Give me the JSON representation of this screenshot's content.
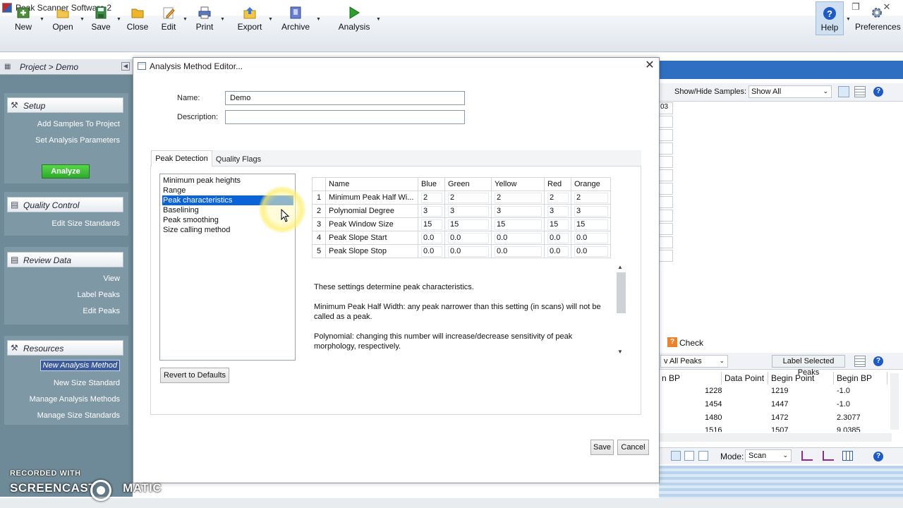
{
  "window": {
    "title": "Peak Scanner Software 2"
  },
  "toolbar": {
    "new": "New",
    "open": "Open",
    "save": "Save",
    "close": "Close",
    "edit": "Edit",
    "print": "Print",
    "export": "Export",
    "archive": "Archive",
    "analysis": "Analysis",
    "help": "Help",
    "preferences": "Preferences"
  },
  "nav": {
    "title": "Project > Demo",
    "setup": "Setup",
    "add_samples": "Add Samples To Project",
    "set_params": "Set Analysis Parameters",
    "analyze": "Analyze",
    "quality_control": "Quality Control",
    "edit_size_standards": "Edit Size Standards",
    "review_data": "Review Data",
    "view": "View",
    "label_peaks": "Label Peaks",
    "edit_peaks": "Edit Peaks",
    "resources": "Resources",
    "new_analysis_method": "New Analysis Method",
    "new_size_standard": "New  Size Standard",
    "manage_analysis_methods": "Manage Analysis Methods",
    "manage_size_standards": "Manage Size Standards"
  },
  "background": {
    "show_hide_label": "Show/Hide Samples:",
    "show_hide_value": "Show All",
    "sample_fragment": "03",
    "check": "Check",
    "peaks_filter": "v All Peaks",
    "label_selected_peaks": "Label Selected Peaks",
    "columns": [
      "n BP",
      "Data Point",
      "Begin Point",
      "Begin BP"
    ],
    "rows": [
      [
        "",
        "1228",
        "1219",
        "-1.0"
      ],
      [
        "",
        "1454",
        "1447",
        "-1.0"
      ],
      [
        "",
        "1480",
        "1472",
        "2.3077"
      ],
      [
        "",
        "1516",
        "1507",
        "9.0385"
      ]
    ],
    "mode_label": "Mode:",
    "mode_value": "Scan"
  },
  "dialog": {
    "title": "Analysis Method Editor...",
    "name_label": "Name:",
    "name_value": "Demo",
    "description_label": "Description:",
    "description_value": "",
    "tabs": [
      "Peak Detection",
      "Quality Flags"
    ],
    "list": [
      "Minimum peak heights",
      "Range",
      "Peak characteristics",
      "Baselining",
      "Peak smoothing",
      "Size calling method"
    ],
    "selected_list_index": 2,
    "table": {
      "columns": [
        "Name",
        "Blue",
        "Green",
        "Yellow",
        "Red",
        "Orange"
      ],
      "rows": [
        {
          "idx": "1",
          "name": "Minimum Peak Half Wi...",
          "values": [
            "2",
            "2",
            "2",
            "2",
            "2"
          ]
        },
        {
          "idx": "2",
          "name": "Polynomial Degree",
          "values": [
            "3",
            "3",
            "3",
            "3",
            "3"
          ]
        },
        {
          "idx": "3",
          "name": "Peak Window Size",
          "values": [
            "15",
            "15",
            "15",
            "15",
            "15"
          ]
        },
        {
          "idx": "4",
          "name": "Peak Slope Start",
          "values": [
            "0.0",
            "0.0",
            "0.0",
            "0.0",
            "0.0"
          ]
        },
        {
          "idx": "5",
          "name": "Peak Slope Stop",
          "values": [
            "0.0",
            "0.0",
            "0.0",
            "0.0",
            "0.0"
          ]
        }
      ]
    },
    "description_text": [
      "These settings determine peak characteristics.",
      "Minimum Peak Half Width: any peak narrower than this setting (in scans) will not be called as a peak.",
      "Polynomial: changing this number will increase/decrease sensitivity of peak morphology, respectively."
    ],
    "revert": "Revert to Defaults",
    "save": "Save",
    "cancel": "Cancel"
  },
  "watermark": {
    "top": "RECORDED WITH",
    "bottom": "SCREENCAST",
    "suffix": "MATIC"
  },
  "colors": {
    "selection": "#0a64d8",
    "nav_bg": "#6e8a98",
    "analyze_green": "#2ea92b"
  }
}
